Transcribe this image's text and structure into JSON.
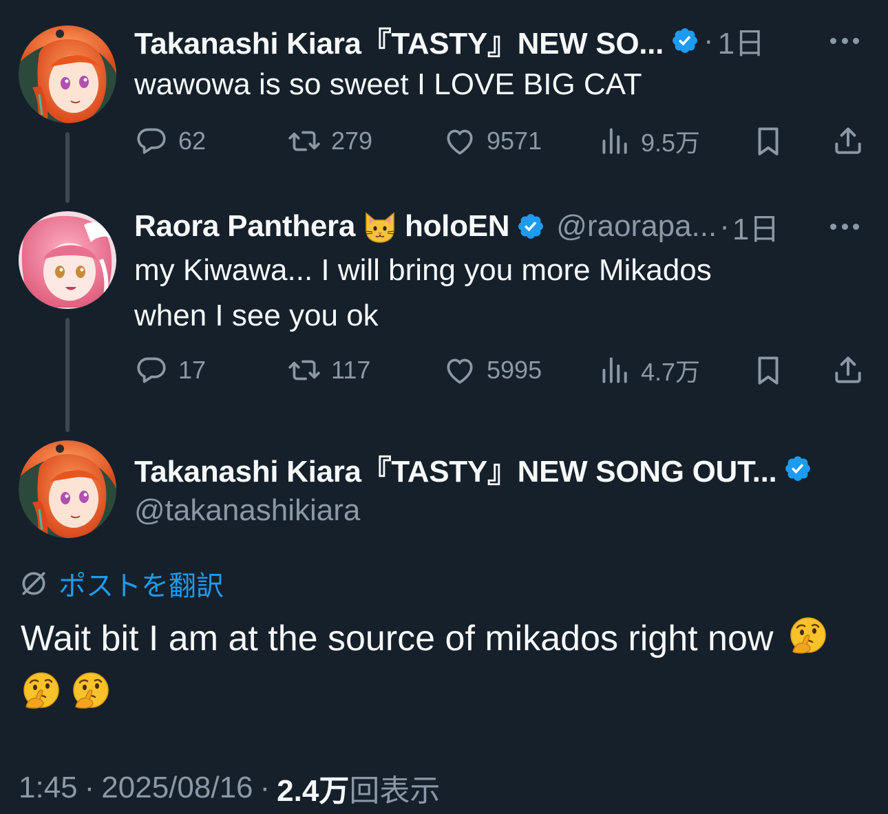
{
  "tweets": [
    {
      "author": "Takanashi Kiara『TASTY』NEW SO...",
      "time": "1日",
      "text": "wawowa is so sweet I LOVE BIG CAT",
      "replies": "62",
      "retweets": "279",
      "likes": "9571",
      "views": "9.5万"
    },
    {
      "author": "Raora Panthera",
      "author_suffix": "holoEN",
      "handle": "@raorapa...",
      "time": "1日",
      "text_line1": "my Kiwawa... I will bring you more Mikados",
      "text_line2": "when I see you ok",
      "replies": "17",
      "retweets": "117",
      "likes": "5995",
      "views": "4.7万"
    }
  ],
  "main": {
    "author": "Takanashi Kiara『TASTY』NEW SONG OUT...",
    "handle": "@takanashikiara",
    "translate_label": "ポストを翻訳",
    "text": "Wait bit I am at the source of mikados right now",
    "time": "1:45",
    "date": "2025/08/16",
    "views_count": "2.4万",
    "views_label": "回表示"
  },
  "separator": "·",
  "colors": {
    "background": "#15202b",
    "accent": "#1d9bf0",
    "muted": "#8b98a5",
    "text": "#f7f9f9"
  },
  "icons": [
    "verified-badge-icon",
    "more-icon",
    "reply-icon",
    "retweet-icon",
    "like-icon",
    "views-icon",
    "bookmark-icon",
    "share-icon",
    "cat-emoji-icon",
    "translate-icon",
    "thinking-emoji-icon"
  ]
}
